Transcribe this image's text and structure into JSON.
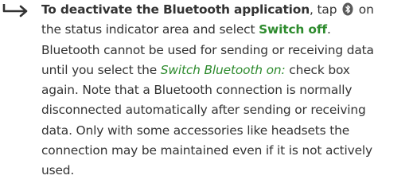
{
  "instruction": {
    "lead_bold": "To deactivate the Bluetooth application",
    "text_1": ", tap ",
    "icon": "bluetooth-icon",
    "text_2": " on\nthe status indicator area and select ",
    "switch_off": "Switch off",
    "text_3": ".\nBluetooth cannot be used for sending or receiving data\nuntil you select the ",
    "checkbox_label": "Switch Bluetooth on:",
    "text_4": " check box\nagain. Note that a Bluetooth connection is normally\ndisconnected automatically after sending or receiving\ndata. Only with some accessories like headsets the\nconnection may be maintained even if it is not actively\nused."
  },
  "colors": {
    "text": "#333333",
    "accent": "#2e8b2e"
  }
}
